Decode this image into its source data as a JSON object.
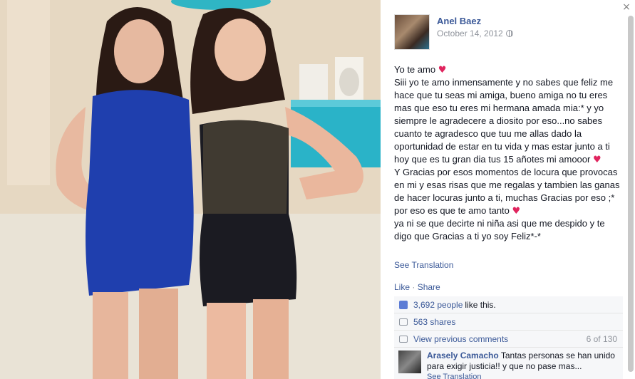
{
  "author": {
    "name": "Anel Baez",
    "date": "October 14, 2012"
  },
  "post": {
    "lines": [
      "Yo te amo",
      "Siii yo te amo inmensamente y no sabes que feliz me hace que tu seas mi amiga, bueno amiga no tu eres mas que eso tu eres mi hermana amada mia:* y yo siempre le agradecere a diosito por eso...no sabes cuanto te agradesco que tuu me allas dado la oportunidad de estar en tu vida y mas estar junto a ti hoy que es tu gran dia tus 15 añotes mi amooor",
      "Y Gracias por esos momentos de locura que provocas en mi y esas risas que me regalas y tambien las ganas de hacer locuras junto a ti, muchas Gracias por eso ;*",
      "por eso es que te amo tanto",
      "ya ni se que decirte ni niña asi que me despido y te digo que Gracias a ti yo soy Feliz*-*"
    ],
    "see_translation": "See Translation"
  },
  "actions": {
    "like": "Like",
    "share": "Share"
  },
  "ufi": {
    "likes_link": "3,692 people",
    "likes_text": "like this.",
    "shares": "563 shares",
    "view_previous": "View previous comments",
    "comment_count": "6 of 130"
  },
  "comment": {
    "name": "Arasely Camacho",
    "text": "Tantas personas se han unido para exigir justicia!! y que no pase mas...",
    "translation": "See Translation"
  },
  "close": "×",
  "colors": {
    "link": "#3b5998",
    "heart": "#e0245e",
    "dress_blue": "#1f3fae",
    "table_teal": "#2ab3c8"
  }
}
